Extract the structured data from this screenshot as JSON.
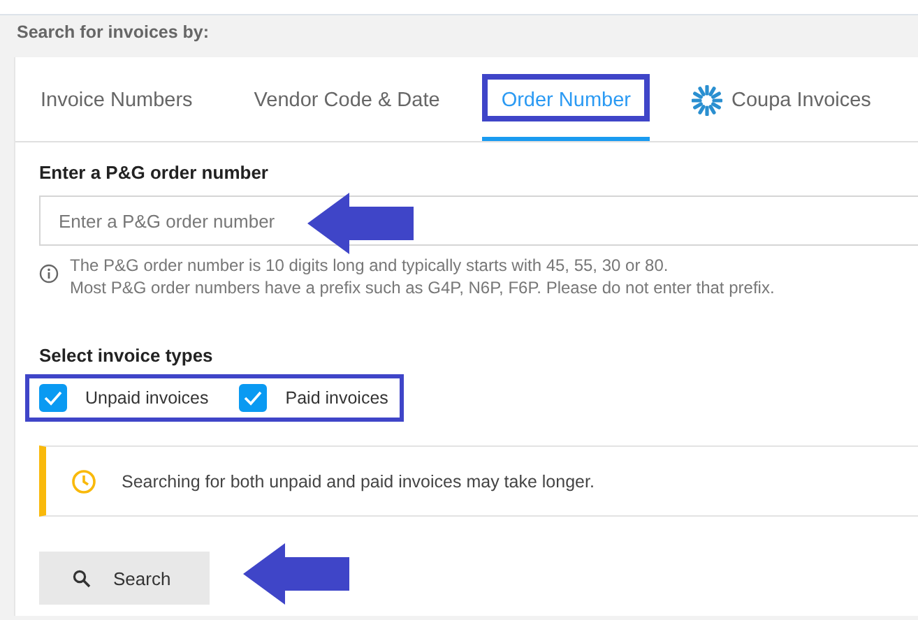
{
  "header": {
    "title": "Search for invoices by:"
  },
  "tabs": [
    {
      "label": "Invoice Numbers",
      "selected": false,
      "kind": "text"
    },
    {
      "label": "Vendor Code & Date",
      "selected": false,
      "kind": "text"
    },
    {
      "label": "Order Number",
      "selected": true,
      "kind": "text"
    },
    {
      "label": "Coupa Invoices",
      "selected": false,
      "kind": "logo"
    }
  ],
  "order_field": {
    "label": "Enter a P&G order number",
    "placeholder": "Enter a P&G order number",
    "hint": [
      "The P&G order number is 10 digits long and typically starts with 45, 55, 30 or 80.",
      "Most P&G order numbers have a prefix such as G4P, N6P, F6P. Please do not enter that prefix."
    ]
  },
  "invoice_types": {
    "label": "Select invoice types",
    "options": [
      {
        "label": "Unpaid invoices",
        "checked": true
      },
      {
        "label": "Paid invoices",
        "checked": true
      }
    ]
  },
  "notice": {
    "text": "Searching for both unpaid and paid invoices may take longer."
  },
  "search_button": {
    "label": "Search"
  }
}
